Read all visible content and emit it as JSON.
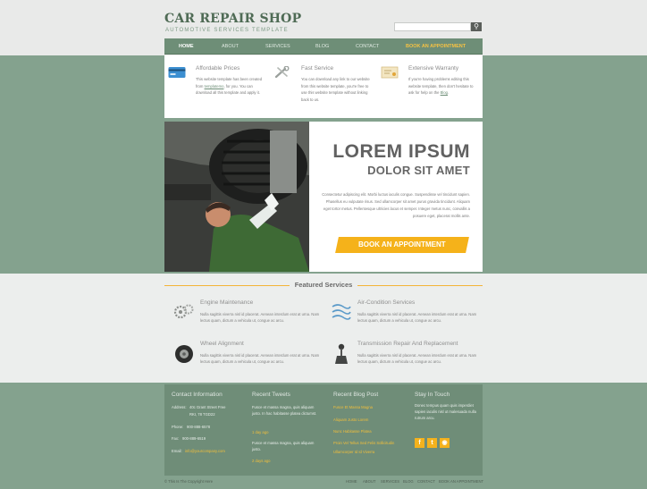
{
  "header": {
    "logo_title": "CAR REPAIR SHOP",
    "logo_sub": "AUTOMOTIVE SERVICES TEMPLATE"
  },
  "nav": {
    "items": [
      "HOME",
      "ABOUT",
      "SERVICES",
      "BLOG",
      "CONTACT",
      "BOOK AN APPOINTMENT"
    ]
  },
  "services": [
    {
      "icon": "credit-card-icon",
      "title": "Affordable Prices",
      "text_pre": "This website template has been created from ",
      "link": "templatemo",
      "text_post": ", for you. You can download all this template and apply it."
    },
    {
      "icon": "wrench-icon",
      "title": "Fast Service",
      "text": "You can download any link to our website from this website template, you're free to use this website template without linking back to us."
    },
    {
      "icon": "certificate-icon",
      "title": "Extensive Warranty",
      "text_pre": "If you're having problems editing this website template, then don't hesitate to ask for help on the ",
      "link": "Blog",
      "text_post": "."
    }
  ],
  "hero": {
    "title": "LOREM IPSUM",
    "subtitle": "DOLOR SIT AMET",
    "text": "Consectetur adipiscing elit. Morbi luctus iaculis congue. Suspendisse vel tincidunt sapien. Phasellus eu vulputate risus. Sed ullamcorper sit amet purus gravida tincidunt. Aliquam eget tortor metus. Pellentesque ultricies lacus et semper. Integer metus nunc, convallis a posuere eget, placerat mollis ante.",
    "cta": "BOOK AN APPOINTMENT"
  },
  "featured": {
    "title": "Featured Services",
    "items": [
      {
        "icon": "gears-icon",
        "title": "Engine Maintenance",
        "text": "Nulla sagittis viverra nisl id placerat. Aenean interdum erat at urna. Nam lectus quam, dictum a vehicula ut, congue ac arcu."
      },
      {
        "icon": "ac-icon",
        "title": "Air-Condition Services",
        "text": "Nulla sagittis viverra nisl id placerat. Aenean interdum erat at urna. Nam lectus quam, dictum a vehicula ut, congue ac arcu."
      },
      {
        "icon": "tire-icon",
        "title": "Wheel Alignment",
        "text": "Nulla sagittis viverra nisl id placerat. Aenean interdum erat at urna. Nam lectus quam, dictum a vehicula ut, congue ac arcu."
      },
      {
        "icon": "gearshift-icon",
        "title": "Transmission Repair And Replacement",
        "text": "Nulla sagittis viverra nisl id placerat. Aenean interdum erat at urna. Nam lectus quam, dictum a vehicula ut, congue ac arcu."
      }
    ]
  },
  "footer": {
    "contact": {
      "heading": "Contact Information",
      "address_label": "Address:",
      "address": "40c Grant Street Free",
      "address2": "RKI, 78 TGD22",
      "phone_label": "Phone:",
      "phone": "900-888-6578",
      "fax_label": "Fax:",
      "fax": "900-889-6519",
      "email_label": "Email:",
      "email": "info@yourcompany.com"
    },
    "tweets": {
      "heading": "Recent Tweets",
      "items": [
        {
          "text": "Fusce et massa magna, quis aliquam justo. In hac habitasse platea dictumst.",
          "time": "1 day ago"
        },
        {
          "text": "Fusce et massa magna, quis aliquam justo.",
          "time": "2 days ago"
        }
      ]
    },
    "blog": {
      "heading": "Recent Blog Post",
      "items": [
        "Fusce Et Massa Magna",
        "Aliquam Justo Lorem",
        "Nunc Habitasse Platea",
        "Proin Vel Tellus Sed Felis Sollicitudin",
        "Ullamcorper Id Id Viverra"
      ]
    },
    "stay": {
      "heading": "Stay In Touch",
      "text": "Donec tempus quam quis imperdiet sapien iaculis nisl ut malesuada nulla rutrum arcu."
    },
    "copyright": "© This Is The Copyright Here",
    "bottom_nav": [
      "HOME",
      "ABOUT",
      "SERVICES",
      "BLOG",
      "CONTACT",
      "BOOK AN APPOINTMENT"
    ]
  }
}
